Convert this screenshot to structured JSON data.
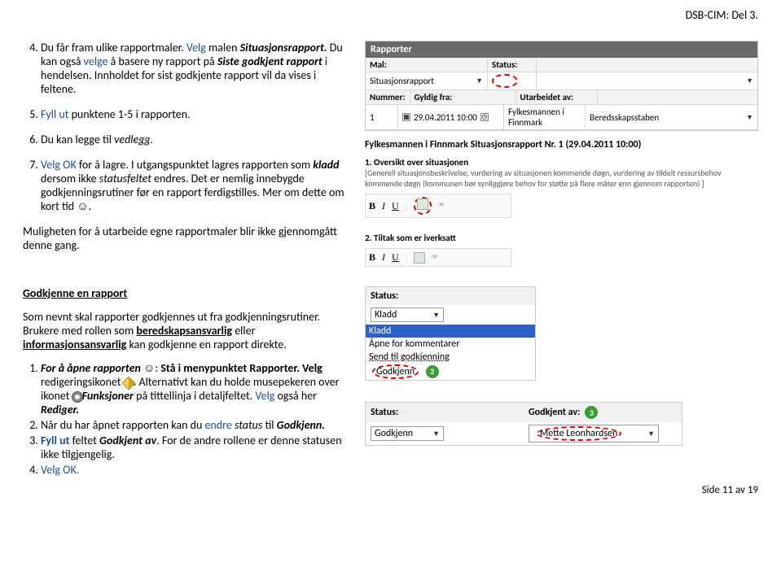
{
  "header": {
    "docTag": "DSB-CIM: Del 3."
  },
  "instr4": {
    "num": "4.",
    "t1": "Du får fram ulike rapportmaler. ",
    "t2": "Velg",
    "t3": " malen ",
    "t4": "Situasjonsrapport.",
    "t5": " Du kan også ",
    "t6": "velge",
    "t7": " å basere ny rapport på ",
    "t8": "Siste godkjent rapport",
    "t9": " i hendelsen. Innholdet for sist godkjente rapport vil da vises i feltene."
  },
  "instr5": {
    "num": "5.",
    "t1": "Fyll ut",
    "t2": " punktene 1-5 i rapporten."
  },
  "instr6": {
    "num": "6.",
    "t1": "Du kan legge til ",
    "t2": "vedlegg."
  },
  "instr7": {
    "num": "7.",
    "t1": "Velg OK",
    "t2": " for å lagre. I utgangspunktet lagres rapporten som ",
    "t3": "kladd",
    "t4": " dersom ikke ",
    "t5": "statusfeltet",
    "t6": " endres. Det er nemlig innebygde godkjenningsrutiner før en rapport ferdigstilles. Mer om dette om kort tid ☺."
  },
  "note1": "Muligheten for å utarbeide egne rapportmaler blir ikke gjennomgått denne gang.",
  "panel": {
    "title": "Rapporter",
    "lbl_mal": "Mal:",
    "val_mal": "Situasjonsrapport",
    "lbl_status": "Status:",
    "lbl_nummer": "Nummer:",
    "val_nummer": "1",
    "lbl_gyldig": "Gyldig fra:",
    "val_gyldig": "29.04.2011 10:00",
    "lbl_utarb_lbl": "Utarbeidet av:",
    "val_utarb1": "Fylkesmannen i Finnmark",
    "val_utarb2": "Beredsskapsstaben"
  },
  "report": {
    "title": "Fylkesmannen i Finnmark Situasjonsrapport Nr. 1 (29.04.2011 10:00)",
    "sub1_num": "1.",
    "sub1_lbl": "Oversikt over situasjonen",
    "sub1_body": "[Generell situasjonsbeskrivelse, vurdering av situasjonen kommende døgn, vurdering av tildelt ressursbehov kommende døgn (kommunen bør synliggjøre behov for støtte på flere måter enn gjennom rapporten) ]",
    "tb_b": "B",
    "tb_i": "I",
    "tb_u": "U",
    "sub2_num": "2.",
    "sub2_lbl": "Tiltak som er iverksatt"
  },
  "approve": {
    "heading": "Godkjenne en rapport",
    "intro1": "Som nevnt skal rapporter godkjennes ut fra godkjenningsrutiner. Brukere med rollen som ",
    "intro2": "beredskapsansvarlig",
    "intro3": " eller ",
    "intro4": "informasjonsansvarlig",
    "intro5": " kan godkjenne en rapport direkte."
  },
  "steps": {
    "s1a": "For å åpne rapporten",
    "s1b": " ☺: ",
    "s1c": "Stå i menypunktet Rapporter. Velg ",
    "s1d": "redigeringsikonet ",
    "s1e": ". Alternativt kan du holde musepekeren over ikonet ",
    "s1f": "Funksjoner",
    "s1g": " på tittellinja i detaljfeltet. ",
    "s1h": "Velg",
    "s1i": " også her ",
    "s1j": "Rediger.",
    "s2a": "Når du har åpnet rapporten kan du ",
    "s2b": "endre ",
    "s2c": "status",
    "s2d": " til ",
    "s2e": "Godkjenn.",
    "s3a": "Fyll ut",
    "s3b": " feltet ",
    "s3c": "Godkjent av",
    "s3d": ". For de andre rollene er denne statusen ikke tilgjengelig.",
    "s4a": "Velg OK."
  },
  "statusBox": {
    "lbl": "Status:",
    "current": "Kladd",
    "opt1": "Kladd",
    "opt2": "Åpne for kommentarer",
    "opt3": "Send til godkjenning",
    "opt4": "Godkjenn",
    "badge2": "2"
  },
  "statusBox2": {
    "lbl_status": "Status:",
    "val_status": "Godkjenn",
    "lbl_godav": "Godkjent av:",
    "val_godav": "Mette Leonhardsen",
    "badge3": "3"
  },
  "footer": {
    "pg": "Side 11 av 19"
  }
}
